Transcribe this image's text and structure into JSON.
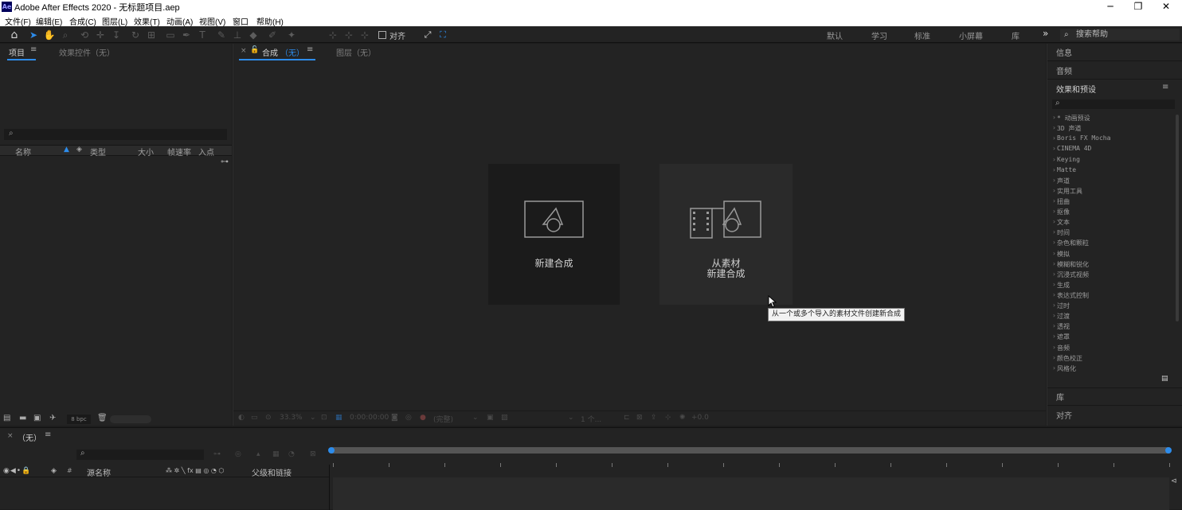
{
  "window": {
    "title": "Adobe After Effects 2020 - 无标题项目.aep",
    "app_icon_text": "Ae",
    "controls": {
      "minimize": "─",
      "maximize": "❐",
      "close": "✕"
    }
  },
  "menu": [
    "文件(F)",
    "编辑(E)",
    "合成(C)",
    "图层(L)",
    "效果(T)",
    "动画(A)",
    "视图(V)",
    "窗口",
    "帮助(H)"
  ],
  "toolbar": {
    "align_label": "对齐",
    "workspaces": [
      "默认",
      "学习",
      "标准",
      "小屏幕",
      "库"
    ],
    "more": "»",
    "search_help_placeholder": "搜索帮助"
  },
  "project_panel": {
    "tabs": {
      "project": "项目",
      "effect_controls": "效果控件（无）"
    },
    "columns": [
      "名称",
      "类型",
      "大小",
      "帧速率",
      "入点"
    ],
    "bpc": "8 bpc"
  },
  "comp_panel": {
    "tab_comp_prefix": "合成",
    "tab_comp_state": "（无）",
    "tab_layer": "图层（无）",
    "card_new_comp": "新建合成",
    "card_from_footage_line1": "从素材",
    "card_from_footage_line2": "新建合成",
    "tooltip": "从一个或多个导入的素材文件创建新合成",
    "footer": {
      "zoom": "33.3%",
      "timecode": "0:00:00:00",
      "resolution": "(完整)",
      "views": "1 个...",
      "exposure": "+0.0"
    }
  },
  "right_panel": {
    "info": "信息",
    "audio": "音频",
    "effects_presets": "效果和预设",
    "effects_list": [
      "* 动画预设",
      "3D 声道",
      "Boris FX Mocha",
      "CINEMA 4D",
      "Keying",
      "Matte",
      "声道",
      "实用工具",
      "扭曲",
      "抠像",
      "文本",
      "时间",
      "杂色和颗粒",
      "模拟",
      "模糊和锐化",
      "沉浸式视频",
      "生成",
      "表达式控制",
      "过时",
      "过渡",
      "透视",
      "遮罩",
      "音频",
      "颜色校正",
      "风格化"
    ],
    "library": "库",
    "align": "对齐"
  },
  "timeline": {
    "tab": "（无）",
    "source_name": "源名称",
    "parent_link": "父级和链接",
    "switch_icons": "⁂ ✲ ╲ fx ▤ ◎ ◔ ⬡",
    "hash": "#"
  }
}
